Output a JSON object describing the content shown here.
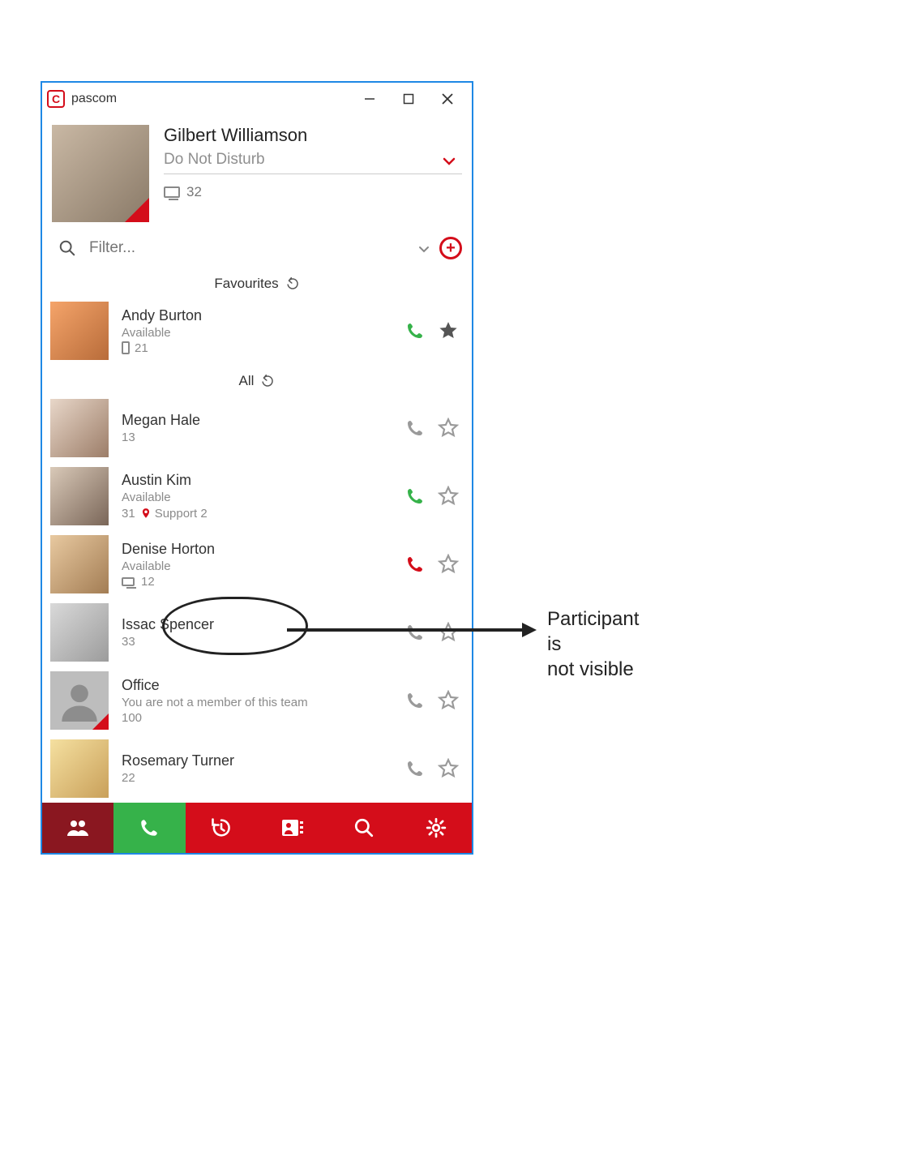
{
  "window": {
    "title": "pascom",
    "logo_letter": "C"
  },
  "profile": {
    "name": "Gilbert Williamson",
    "status": "Do Not Disturb",
    "extension": "32"
  },
  "filter": {
    "placeholder": "Filter..."
  },
  "sections": {
    "favourites_label": "Favourites",
    "all_label": "All"
  },
  "contacts": {
    "favourites": [
      {
        "name": "Andy Burton",
        "status": "Available",
        "ext": "21",
        "phone_color": "green",
        "starred": true,
        "device": "mobile"
      }
    ],
    "all": [
      {
        "name": "Megan Hale",
        "status": "",
        "ext": "13",
        "phone_color": "grey",
        "starred": false
      },
      {
        "name": "Austin Kim",
        "status": "Available",
        "ext": "31",
        "location": "Support 2",
        "phone_color": "green",
        "starred": false
      },
      {
        "name": "Denise Horton",
        "status": "Available",
        "ext": "12",
        "phone_color": "red",
        "starred": false,
        "device": "desktop"
      },
      {
        "name": "Issac Spencer",
        "status": "",
        "ext": "33",
        "phone_color": "grey",
        "starred": false
      },
      {
        "name": "Office",
        "status": "You are not a member of this team",
        "ext": "100",
        "phone_color": "grey",
        "starred": false,
        "is_team": true
      },
      {
        "name": "Rosemary Turner",
        "status": "",
        "ext": "22",
        "phone_color": "grey",
        "starred": false
      }
    ]
  },
  "annotation": {
    "text_line1": "Participant is",
    "text_line2": "not visible"
  }
}
